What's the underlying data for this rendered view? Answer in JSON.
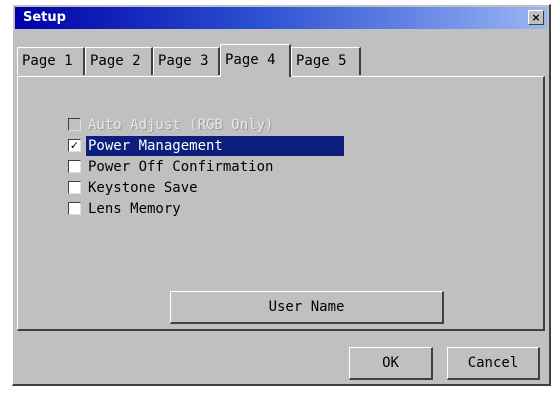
{
  "window": {
    "title": "Setup",
    "close_label": "×"
  },
  "tabs": [
    {
      "label": "Page 1",
      "active": false
    },
    {
      "label": "Page 2",
      "active": false
    },
    {
      "label": "Page 3",
      "active": false
    },
    {
      "label": "Page 4",
      "active": true
    },
    {
      "label": "Page 5",
      "active": false
    }
  ],
  "options": [
    {
      "label": "Auto Adjust (RGB Only)",
      "checked": false,
      "disabled": true,
      "selected": false
    },
    {
      "label": "Power Management",
      "checked": true,
      "disabled": false,
      "selected": true
    },
    {
      "label": "Power Off Confirmation",
      "checked": false,
      "disabled": false,
      "selected": false
    },
    {
      "label": "Keystone Save",
      "checked": false,
      "disabled": false,
      "selected": false
    },
    {
      "label": "Lens Memory",
      "checked": false,
      "disabled": false,
      "selected": false
    }
  ],
  "buttons": {
    "user_name": "User Name",
    "ok": "OK",
    "cancel": "Cancel"
  },
  "colors": {
    "title_bar": "#0000a8",
    "selection": "#0d1e7c",
    "face": "#c0c0c0"
  }
}
